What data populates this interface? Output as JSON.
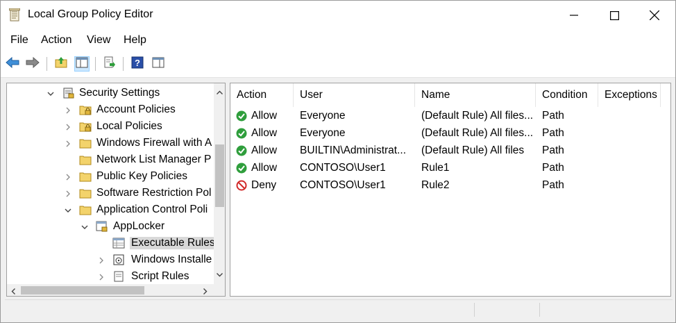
{
  "window": {
    "title": "Local Group Policy Editor",
    "icons": {
      "app": "policy-scroll-icon",
      "minimize": "minimize-icon",
      "maximize": "maximize-icon",
      "close": "close-icon"
    }
  },
  "menu": {
    "items": [
      "File",
      "Action",
      "View",
      "Help"
    ]
  },
  "toolbar": {
    "icons": [
      "back-arrow-icon",
      "forward-arrow-icon",
      "up-folder-icon",
      "show-hide-tree-icon",
      "export-list-icon",
      "help-icon",
      "properties-pane-icon"
    ],
    "pressed": "show-hide-tree-icon"
  },
  "tree": {
    "items": [
      {
        "label": "Security Settings",
        "icon": "security-settings-icon",
        "expander": "expanded"
      },
      {
        "label": "Account Policies",
        "icon": "locked-folder-icon",
        "expander": "collapsed"
      },
      {
        "label": "Local Policies",
        "icon": "locked-folder-icon",
        "expander": "collapsed"
      },
      {
        "label": "Windows Firewall with A",
        "icon": "folder-icon",
        "expander": "collapsed"
      },
      {
        "label": "Network List Manager P",
        "icon": "folder-icon",
        "expander": "none"
      },
      {
        "label": "Public Key Policies",
        "icon": "folder-icon",
        "expander": "collapsed"
      },
      {
        "label": "Software Restriction Pol",
        "icon": "folder-icon",
        "expander": "collapsed"
      },
      {
        "label": "Application Control Poli",
        "icon": "folder-icon",
        "expander": "expanded"
      },
      {
        "label": "AppLocker",
        "icon": "applocker-icon",
        "expander": "expanded"
      },
      {
        "label": "Executable Rules",
        "icon": "rules-table-icon",
        "expander": "none",
        "selected": true
      },
      {
        "label": "Windows Installe",
        "icon": "installer-icon",
        "expander": "collapsed"
      },
      {
        "label": "Script Rules",
        "icon": "script-icon",
        "expander": "collapsed"
      }
    ]
  },
  "list": {
    "columns": [
      "Action",
      "User",
      "Name",
      "Condition",
      "Exceptions"
    ],
    "rows": [
      {
        "action": "Allow",
        "status": "allow",
        "user": "Everyone",
        "name": "(Default Rule) All files...",
        "condition": "Path",
        "exceptions": ""
      },
      {
        "action": "Allow",
        "status": "allow",
        "user": "Everyone",
        "name": "(Default Rule) All files...",
        "condition": "Path",
        "exceptions": ""
      },
      {
        "action": "Allow",
        "status": "allow",
        "user": "BUILTIN\\Administrat...",
        "name": "(Default Rule) All files",
        "condition": "Path",
        "exceptions": ""
      },
      {
        "action": "Allow",
        "status": "allow",
        "user": "CONTOSO\\User1",
        "name": "Rule1",
        "condition": "Path",
        "exceptions": ""
      },
      {
        "action": "Deny",
        "status": "deny",
        "user": "CONTOSO\\User1",
        "name": "Rule2",
        "condition": "Path",
        "exceptions": ""
      }
    ],
    "icons": {
      "allow": "allow-check-icon",
      "deny": "deny-circle-icon"
    },
    "colors": {
      "allow": "#2f9e3c",
      "deny": "#d12b2b"
    }
  },
  "colors": {
    "selection": "#d9d9d9",
    "pressed": "#cce8ff",
    "accent_blue": "#1f73c8"
  }
}
